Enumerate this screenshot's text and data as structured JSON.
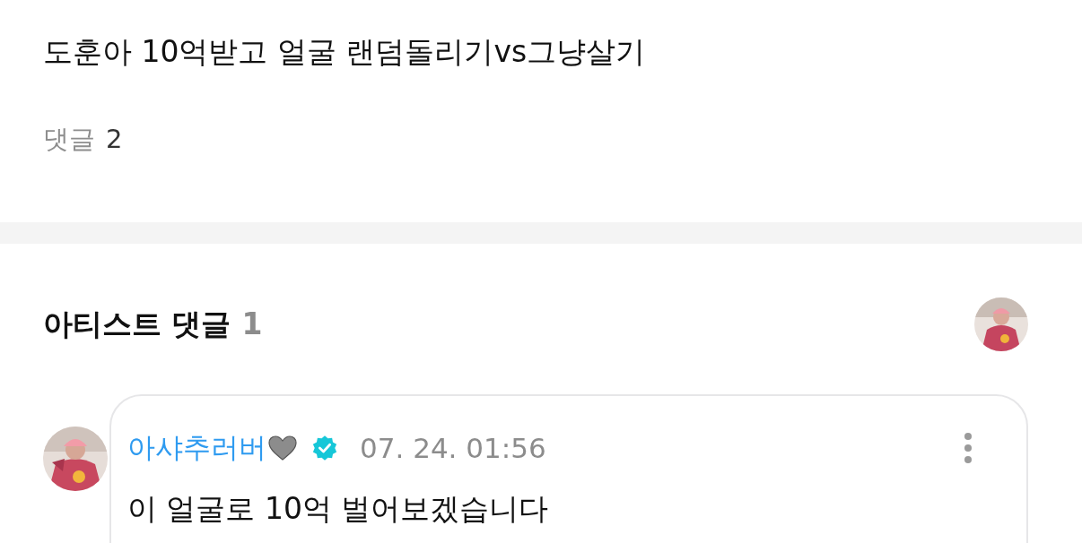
{
  "post": {
    "title": "도훈아 10억받고 얼굴 랜덤돌리기vs그냥살기",
    "comments_label": "댓글",
    "comments_count": "2"
  },
  "artist_comments": {
    "heading": "아티스트 댓글",
    "count": "1",
    "comments": [
      {
        "author": "아샤추러버",
        "verified": true,
        "time": "07. 24. 01:56",
        "text": "이 얼굴로 10억 벌어보겠습니다"
      }
    ]
  }
}
